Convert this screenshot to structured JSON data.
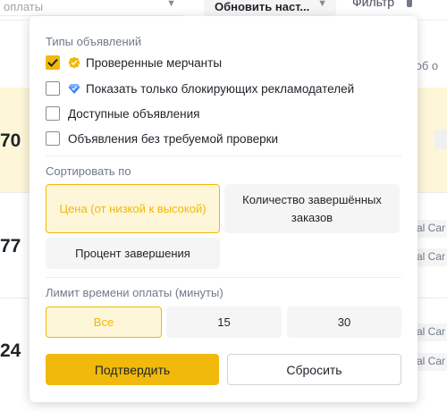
{
  "background": {
    "top_field": "оплаты",
    "refresh_label": "Обновить наст...",
    "filter_label": "Фильтр",
    "right_text": "соб о",
    "rows": [
      {
        "num": "70",
        "tag": ""
      },
      {
        "num": "77",
        "tag1": "al Car",
        "tag2": "al Car"
      },
      {
        "num": "24",
        "tag1": "al Car",
        "tag2": "al Car"
      }
    ]
  },
  "popup": {
    "types_title": "Типы объявлений",
    "options": [
      {
        "label": "Проверенные мерчанты",
        "checked": true
      },
      {
        "label": "Показать только блокирующих рекламодателей",
        "checked": false
      },
      {
        "label": "Доступные объявления",
        "checked": false
      },
      {
        "label": "Объявления без требуемой проверки",
        "checked": false
      }
    ],
    "sort_title": "Сортировать по",
    "sort": {
      "price": "Цена (от низкой к высокой)",
      "completed": "Количество завершённых заказов",
      "rate": "Процент завершения"
    },
    "time_title": "Лимит времени оплаты (минуты)",
    "time": {
      "all": "Все",
      "t15": "15",
      "t30": "30"
    },
    "confirm": "Подтвердить",
    "reset": "Сбросить"
  },
  "colors": {
    "accent": "#f0b90b",
    "accent_bg": "#fef6d8",
    "badge_blue": "#3b82f6"
  }
}
